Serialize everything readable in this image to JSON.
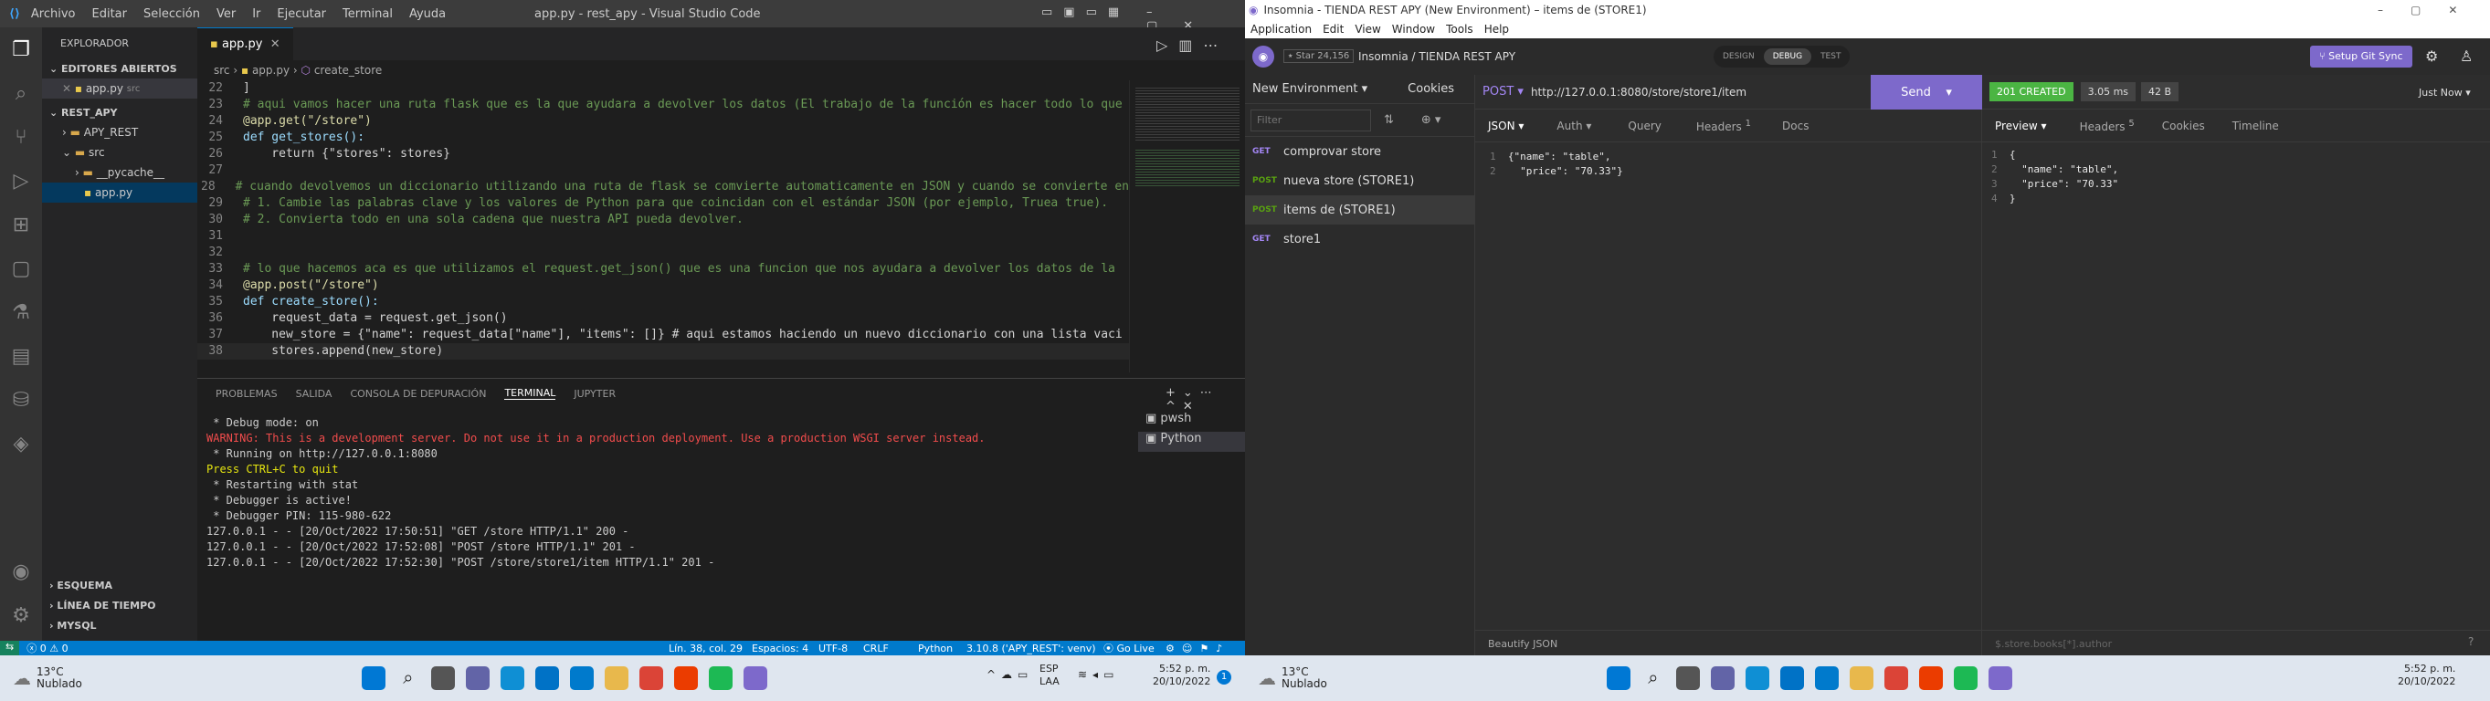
{
  "vscode": {
    "menu": [
      "Archivo",
      "Editar",
      "Selección",
      "Ver",
      "Ir",
      "Ejecutar",
      "Terminal",
      "Ayuda"
    ],
    "title": "app.py - rest_apy - Visual Studio Code",
    "explorer_label": "EXPLORADOR",
    "open_editors_label": "EDITORES ABIERTOS",
    "open_file": "app.py",
    "open_file_path": "src",
    "workspace": "REST_APY",
    "tree": [
      "APY_REST",
      "src",
      "__pycache__",
      "app.py"
    ],
    "outline_sections": [
      "ESQUEMA",
      "LÍNEA DE TIEMPO",
      "MYSQL"
    ],
    "tab_label": "app.py",
    "breadcrumb": [
      "src",
      "app.py",
      "create_store"
    ],
    "code_lines": [
      {
        "n": "22",
        "t": "]"
      },
      {
        "n": "23",
        "t": "# aqui vamos hacer una ruta flask que es la que ayudara a devolver los datos (El trabajo de la función es hacer todo lo que"
      },
      {
        "n": "24",
        "t": "@app.get(\"/store\")"
      },
      {
        "n": "25",
        "t": "def get_stores():"
      },
      {
        "n": "26",
        "t": "    return {\"stores\": stores}"
      },
      {
        "n": "27",
        "t": ""
      },
      {
        "n": "28",
        "t": "# cuando devolvemos un diccionario utilizando una ruta de flask se comvierte automaticamente en JSON y cuando se convierte en"
      },
      {
        "n": "29",
        "t": "# 1. Cambie las palabras clave y los valores de Python para que coincidan con el estándar JSON (por ejemplo, Truea true)."
      },
      {
        "n": "30",
        "t": "# 2. Convierta todo en una sola cadena que nuestra API pueda devolver."
      },
      {
        "n": "31",
        "t": ""
      },
      {
        "n": "32",
        "t": ""
      },
      {
        "n": "33",
        "t": "# lo que hacemos aca es que utilizamos el request.get_json() que es una funcion que nos ayudara a devolver los datos de la"
      },
      {
        "n": "34",
        "t": "@app.post(\"/store\")"
      },
      {
        "n": "35",
        "t": "def create_store():"
      },
      {
        "n": "36",
        "t": "    request_data = request.get_json()"
      },
      {
        "n": "37",
        "t": "    new_store = {\"name\": request_data[\"name\"], \"items\": []} # aqui estamos haciendo un nuevo diccionario con una lista vaci"
      },
      {
        "n": "38",
        "t": "    stores.append(new_store)"
      }
    ],
    "panel_tabs": [
      "PROBLEMAS",
      "SALIDA",
      "CONSOLA DE DEPURACIÓN",
      "TERMINAL",
      "JUPYTER"
    ],
    "terminal_lines": [
      " * Debug mode: on",
      "WARNING: This is a development server. Do not use it in a production deployment. Use a production WSGI server instead.",
      " * Running on http://127.0.0.1:8080",
      "Press CTRL+C to quit",
      " * Restarting with stat",
      " * Debugger is active!",
      " * Debugger PIN: 115-980-622",
      "127.0.0.1 - - [20/Oct/2022 17:50:51] \"GET /store HTTP/1.1\" 200 -",
      "127.0.0.1 - - [20/Oct/2022 17:52:08] \"POST /store HTTP/1.1\" 201 -",
      "127.0.0.1 - - [20/Oct/2022 17:52:30] \"POST /store/store1/item HTTP/1.1\" 201 -"
    ],
    "shells": [
      "pwsh",
      "Python"
    ],
    "status": {
      "errors": "0",
      "warnings": "0",
      "position": "Lín. 38, col. 29",
      "spaces": "Espacios: 4",
      "encoding": "UTF-8",
      "eol": "CRLF",
      "lang": "Python",
      "interpreter": "3.10.8 ('APY_REST': venv)",
      "golive": "Go Live"
    }
  },
  "insomnia": {
    "title": "Insomnia - TIENDA REST APY (New Environment) – items de (STORE1)",
    "menu": [
      "Application",
      "Edit",
      "View",
      "Window",
      "Tools",
      "Help"
    ],
    "star": "Star",
    "stars": "24,156",
    "workspace": "Insomnia / TIENDA REST APY",
    "modes": [
      "DESIGN",
      "DEBUG",
      "TEST"
    ],
    "git": "Setup Git Sync",
    "env": "New Environment",
    "cookies": "Cookies",
    "filter": "Filter",
    "requests": [
      {
        "m": "GET",
        "name": "comprovar store"
      },
      {
        "m": "POST",
        "name": "nueva store (STORE1)"
      },
      {
        "m": "POST",
        "name": "items de (STORE1)"
      },
      {
        "m": "GET",
        "name": "store1"
      }
    ],
    "method": "POST",
    "url": "http://127.0.0.1:8080/store/store1/item",
    "send": "Send",
    "req_tabs": [
      "JSON",
      "Auth",
      "Query",
      "Headers",
      "Docs"
    ],
    "req_headers_count": "1",
    "req_body": [
      "{\"name\": \"table\",",
      "  \"price\": \"70.33\"}"
    ],
    "beautify": "Beautify JSON",
    "status": "201 CREATED",
    "time": "3.05 ms",
    "size": "42 B",
    "when": "Just Now",
    "resp_tabs": [
      "Preview",
      "Headers",
      "Cookies",
      "Timeline"
    ],
    "resp_headers_count": "5",
    "resp_body": [
      "{",
      "  \"name\": \"table\",",
      "  \"price\": \"70.33\"",
      "}"
    ],
    "filter_hint": "$.store.books[*].author"
  },
  "taskbar": {
    "temp": "13°C",
    "weather": "Nublado",
    "lang": "ESP",
    "layout": "LAA",
    "time": "5:52 p. m.",
    "date": "20/10/2022",
    "badge": "1"
  }
}
